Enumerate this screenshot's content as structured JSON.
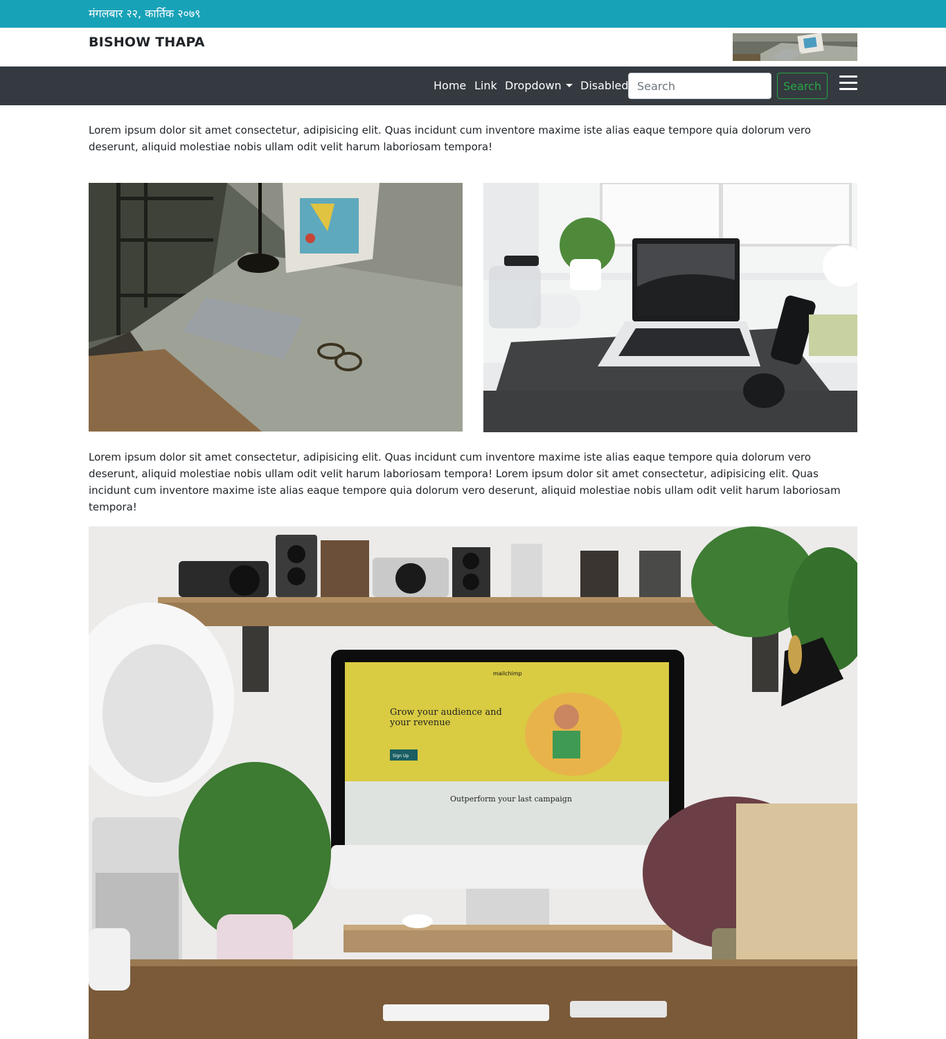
{
  "topbar": {
    "date": "मंगलबार २२, कार्तिक २०७९"
  },
  "header": {
    "brand": "BISHOW THAPA"
  },
  "navbar": {
    "links": [
      "Home",
      "Link",
      "Dropdown",
      "Disabled"
    ],
    "search_placeholder": "Search",
    "search_button": "Search",
    "menu_icon": "hamburger-icon"
  },
  "content": {
    "paragraph_1": "Lorem ipsum dolor sit amet consectetur, adipisicing elit. Quas incidunt cum inventore maxime iste alias eaque tempore quia dolorum vero deserunt, aliquid molestiae nobis ullam odit velit harum laboriosam tempora!",
    "paragraph_2": "Lorem ipsum dolor sit amet consectetur, adipisicing elit. Quas incidunt cum inventore maxime iste alias eaque tempore quia dolorum vero deserunt, aliquid molestiae nobis ullam odit velit harum laboriosam tempora! Lorem ipsum dolor sit amet consectetur, adipisicing elit. Quas incidunt cum inventore maxime iste alias eaque tempore quia dolorum vero deserunt, aliquid molestiae nobis ullam odit velit harum laboriosam tempora!",
    "screen_text": {
      "headline_line_1": "Grow your audience and",
      "headline_line_2": "your revenue",
      "brand": "mailchimp",
      "sub_headline": "Outperform your last campaign",
      "signup": "Sign Up"
    }
  },
  "colors": {
    "topbar": "#17a2b8",
    "navbar": "#343a40",
    "search_button": "#28a745"
  }
}
